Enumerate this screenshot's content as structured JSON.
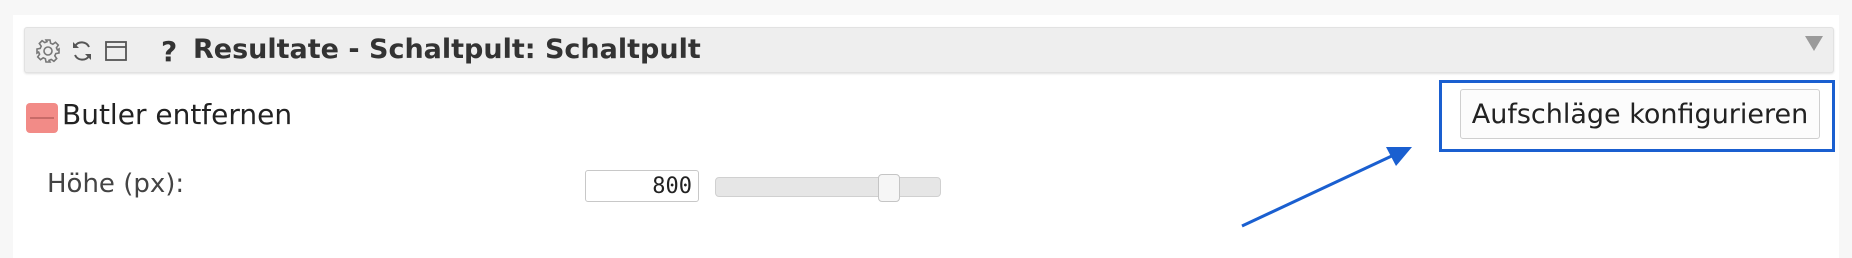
{
  "header": {
    "icons": [
      "gear-icon",
      "refresh-icon",
      "window-icon",
      "help-icon"
    ],
    "help_glyph": "?",
    "title": "Resultate - Schaltpult: Schaltpult",
    "collapse_icon": "triangle-down-icon"
  },
  "butler": {
    "remove_label": "Butler entfernen",
    "remove_icon": "minus-icon",
    "remove_color": "#f28b87"
  },
  "height": {
    "label": "Höhe (px):",
    "value": "800",
    "slider_level": 0.8
  },
  "configure_button": {
    "label": "Aufschläge konfigurieren"
  },
  "annotation": {
    "highlight_color": "#1a5fd0"
  }
}
